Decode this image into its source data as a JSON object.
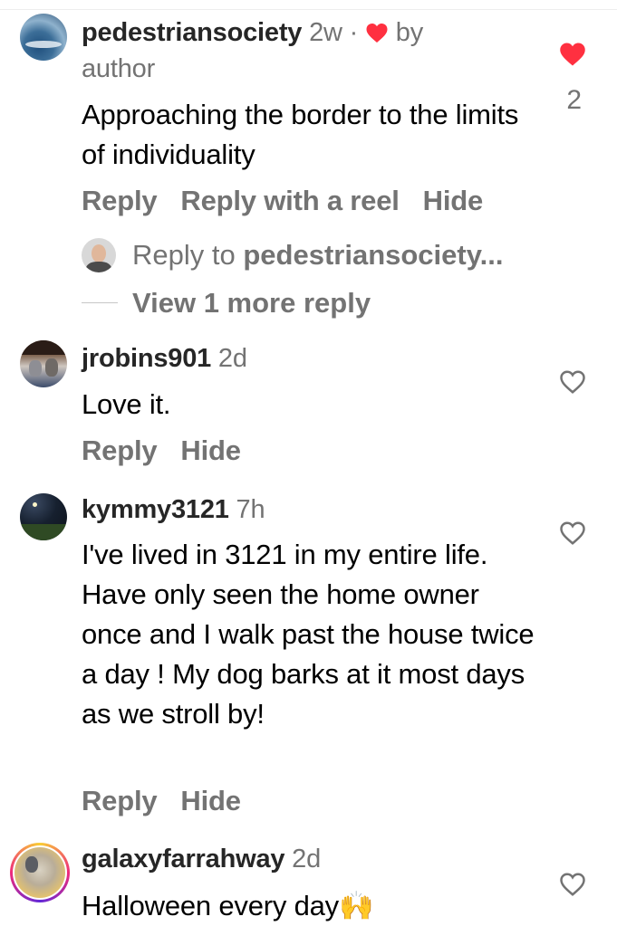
{
  "comments": [
    {
      "username": "pedestriansociety",
      "time": "2w",
      "separator": "·",
      "liked_by_label": "by",
      "liked_by_who": "author",
      "text": "Approaching the border to the limits of individuality",
      "actions": [
        "Reply",
        "Reply with a reel",
        "Hide"
      ],
      "likes": "2",
      "liked": true,
      "reply_prefix": "Reply to",
      "reply_target": "pedestriansociety...",
      "view_more": "View 1 more reply"
    },
    {
      "username": "jrobins901",
      "time": "2d",
      "text": "Love it.",
      "actions": [
        "Reply",
        "Hide"
      ],
      "liked": false
    },
    {
      "username": "kymmy3121",
      "time": "7h",
      "text": "I've lived in 3121 in my entire life. Have only seen the home owner once and I walk past the house twice a day ! My dog barks at it most days as we stroll by!",
      "actions": [
        "Reply",
        "Hide"
      ],
      "liked": false
    },
    {
      "username": "galaxyfarrahway",
      "time": "2d",
      "text": "Halloween every day",
      "emoji": "🙌",
      "liked": false
    }
  ],
  "colors": {
    "like_red": "#ff3040",
    "muted": "#737373"
  },
  "icons": {
    "like": "heart-icon",
    "like_filled": "heart-filled-icon"
  }
}
